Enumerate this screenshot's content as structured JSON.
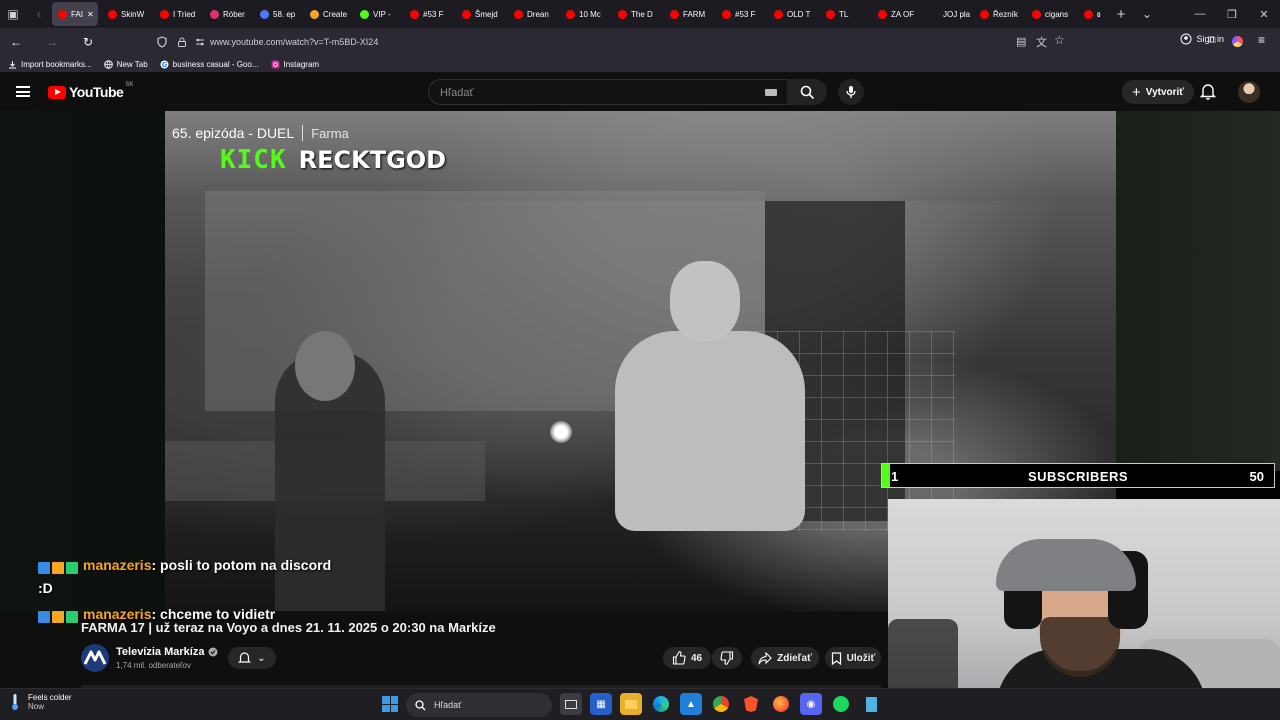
{
  "browser": {
    "tabs": [
      {
        "label": "FAI",
        "color": "#ff0000",
        "active": true
      },
      {
        "label": "SkinW",
        "color": "#ff0000"
      },
      {
        "label": "I Tried",
        "color": "#ff0000"
      },
      {
        "label": "Róber",
        "color": "#e1306c"
      },
      {
        "label": "58. ep",
        "color": "#4f7cff"
      },
      {
        "label": "Create",
        "color": "#f5a623"
      },
      {
        "label": "VIP - ",
        "color": "#53fc18"
      },
      {
        "label": "#53 F",
        "color": "#ff0000"
      },
      {
        "label": "Šmejd",
        "color": "#ff0000"
      },
      {
        "label": "Drean",
        "color": "#ff0000"
      },
      {
        "label": "10 Mc",
        "color": "#ff0000"
      },
      {
        "label": "The D",
        "color": "#ff0000"
      },
      {
        "label": "FARM",
        "color": "#ff0000"
      },
      {
        "label": "#53 F",
        "color": "#ff0000"
      },
      {
        "label": "OLD T",
        "color": "#ff0000"
      },
      {
        "label": "TL",
        "color": "#ff0000"
      },
      {
        "label": "ZA OF",
        "color": "#ff0000"
      },
      {
        "label": "JOJ play",
        "color": "#1c1b22"
      },
      {
        "label": "Řezník",
        "color": "#ff0000"
      },
      {
        "label": "cigans",
        "color": "#ff0000"
      },
      {
        "label": "cc",
        "color": "#ff0000"
      }
    ],
    "url": "www.youtube.com/watch?v=T-m5BD-XI24",
    "sign_in": "Sign in",
    "bookmarks": [
      {
        "label": "Import bookmarks...",
        "icon": "import-icon"
      },
      {
        "label": "New Tab",
        "icon": "globe-icon"
      },
      {
        "label": "business casual - Goo...",
        "icon": "google-icon"
      },
      {
        "label": "Instagram",
        "icon": "instagram-icon"
      }
    ]
  },
  "youtube": {
    "logo_text": "YouTube",
    "country": "SK",
    "search_placeholder": "Hľadať",
    "create_label": "Vytvoriť"
  },
  "video": {
    "episode": "65. epizóda - DUEL",
    "show": "Farma",
    "kick_logo": "KICK",
    "kick_name": "RECKTGOD",
    "title": "FARMA 17 | už teraz na Voyo a dnes 21. 11. 2025 o 20:30 na Markíze",
    "channel_name": "Televízia Markíza",
    "channel_subs": "1,74 mil. odberateľov",
    "likes": "46",
    "share_label": "Zdieľať",
    "save_label": "Uložiť"
  },
  "subscribers_goal": {
    "current": "1",
    "label": "SUBSCRIBERS",
    "goal": "50",
    "progress": 0.02
  },
  "chat": [
    {
      "user": "manazeris",
      "text": ": posli to potom na discord :D"
    },
    {
      "user": "manazeris",
      "text": ": chceme to vidietr"
    }
  ],
  "taskbar": {
    "weather_line1": "Feels colder",
    "weather_line2": "Now",
    "search_label": "Hľadať"
  }
}
